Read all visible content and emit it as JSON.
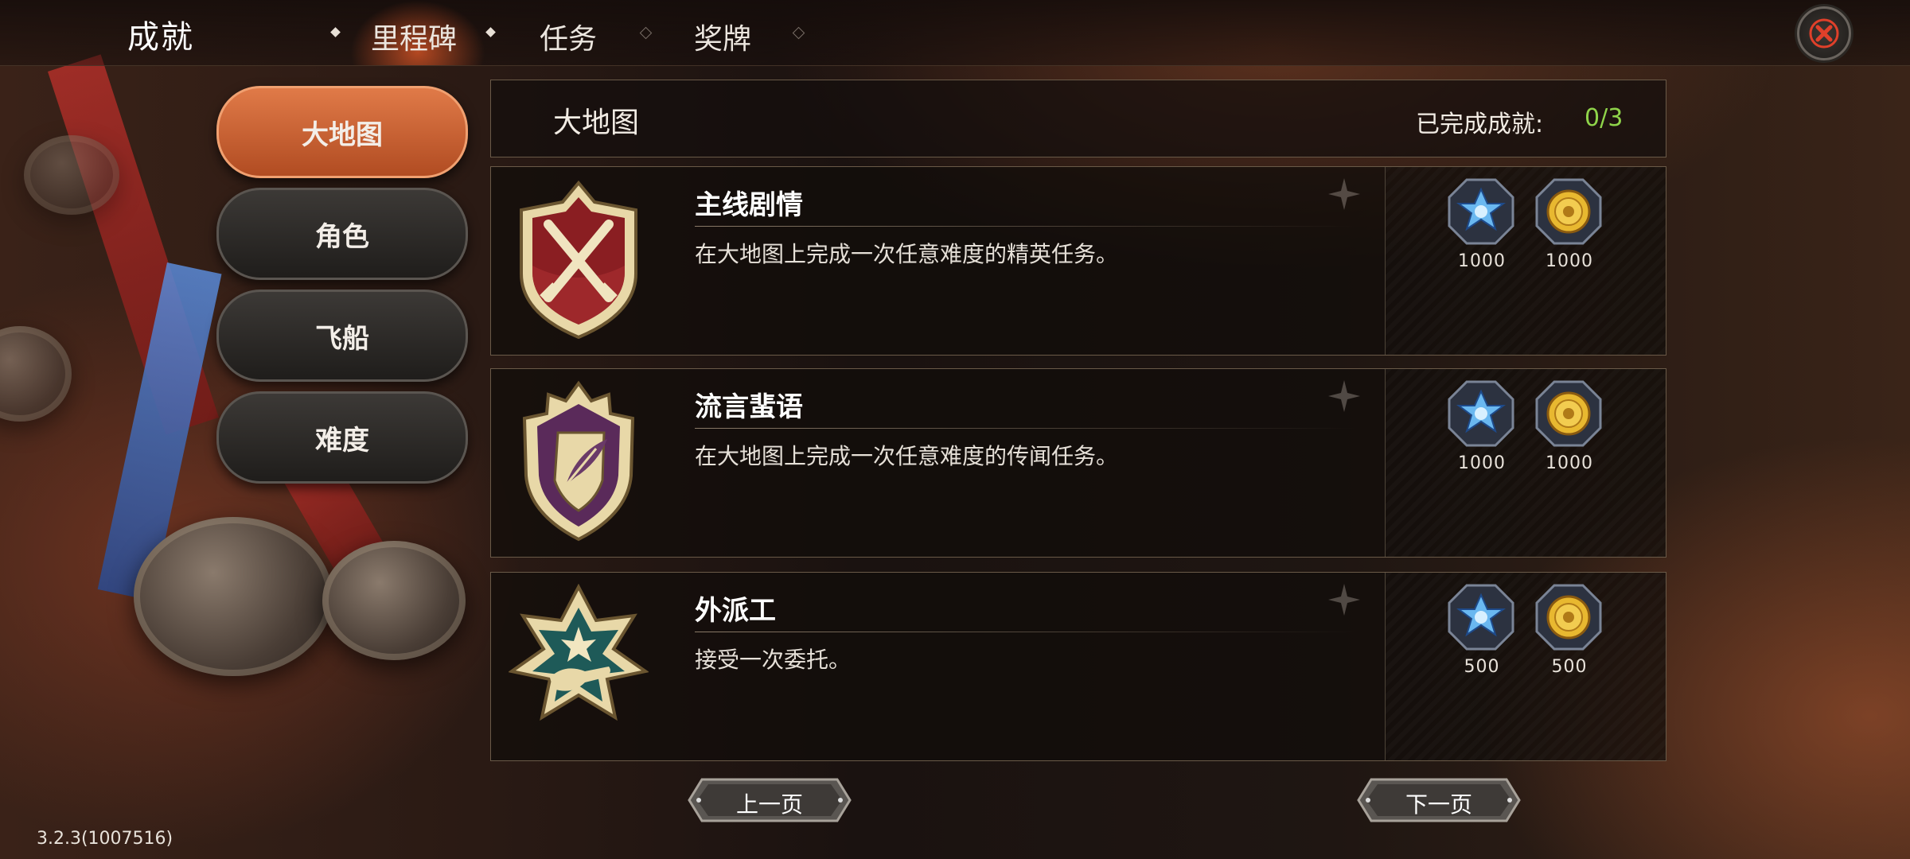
{
  "header": {
    "title": "成就",
    "tabs": [
      {
        "label": "里程碑",
        "active": true
      },
      {
        "label": "任务",
        "active": false
      },
      {
        "label": "奖牌",
        "active": false
      }
    ],
    "close_icon": "close-x-icon"
  },
  "sidebar": {
    "items": [
      {
        "label": "大地图",
        "active": true
      },
      {
        "label": "角色",
        "active": false
      },
      {
        "label": "飞船",
        "active": false
      },
      {
        "label": "难度",
        "active": false
      }
    ]
  },
  "panel": {
    "title": "大地图",
    "completed_label": "已完成成就:",
    "completed_value": "0/3"
  },
  "achievements": [
    {
      "name": "主线剧情",
      "description": "在大地图上完成一次任意难度的精英任务。",
      "badge_icon": "crossed-swords-shield-icon",
      "rewards": [
        {
          "icon": "blue-crystal-icon",
          "amount": "1000"
        },
        {
          "icon": "gold-coin-icon",
          "amount": "1000"
        }
      ]
    },
    {
      "name": "流言蜚语",
      "description": "在大地图上完成一次任意难度的传闻任务。",
      "badge_icon": "feather-shield-icon",
      "rewards": [
        {
          "icon": "blue-crystal-icon",
          "amount": "1000"
        },
        {
          "icon": "gold-coin-icon",
          "amount": "1000"
        }
      ]
    },
    {
      "name": "外派工",
      "description": "接受一次委托。",
      "badge_icon": "hand-star-icon",
      "rewards": [
        {
          "icon": "blue-crystal-icon",
          "amount": "500"
        },
        {
          "icon": "gold-coin-icon",
          "amount": "500"
        }
      ]
    }
  ],
  "pager": {
    "prev_label": "上一页",
    "next_label": "下一页"
  },
  "version": "3.2.3(1007516)",
  "colors": {
    "accent_orange": "#c9602e",
    "progress_green": "#8fd44a",
    "close_red": "#e0402a"
  }
}
